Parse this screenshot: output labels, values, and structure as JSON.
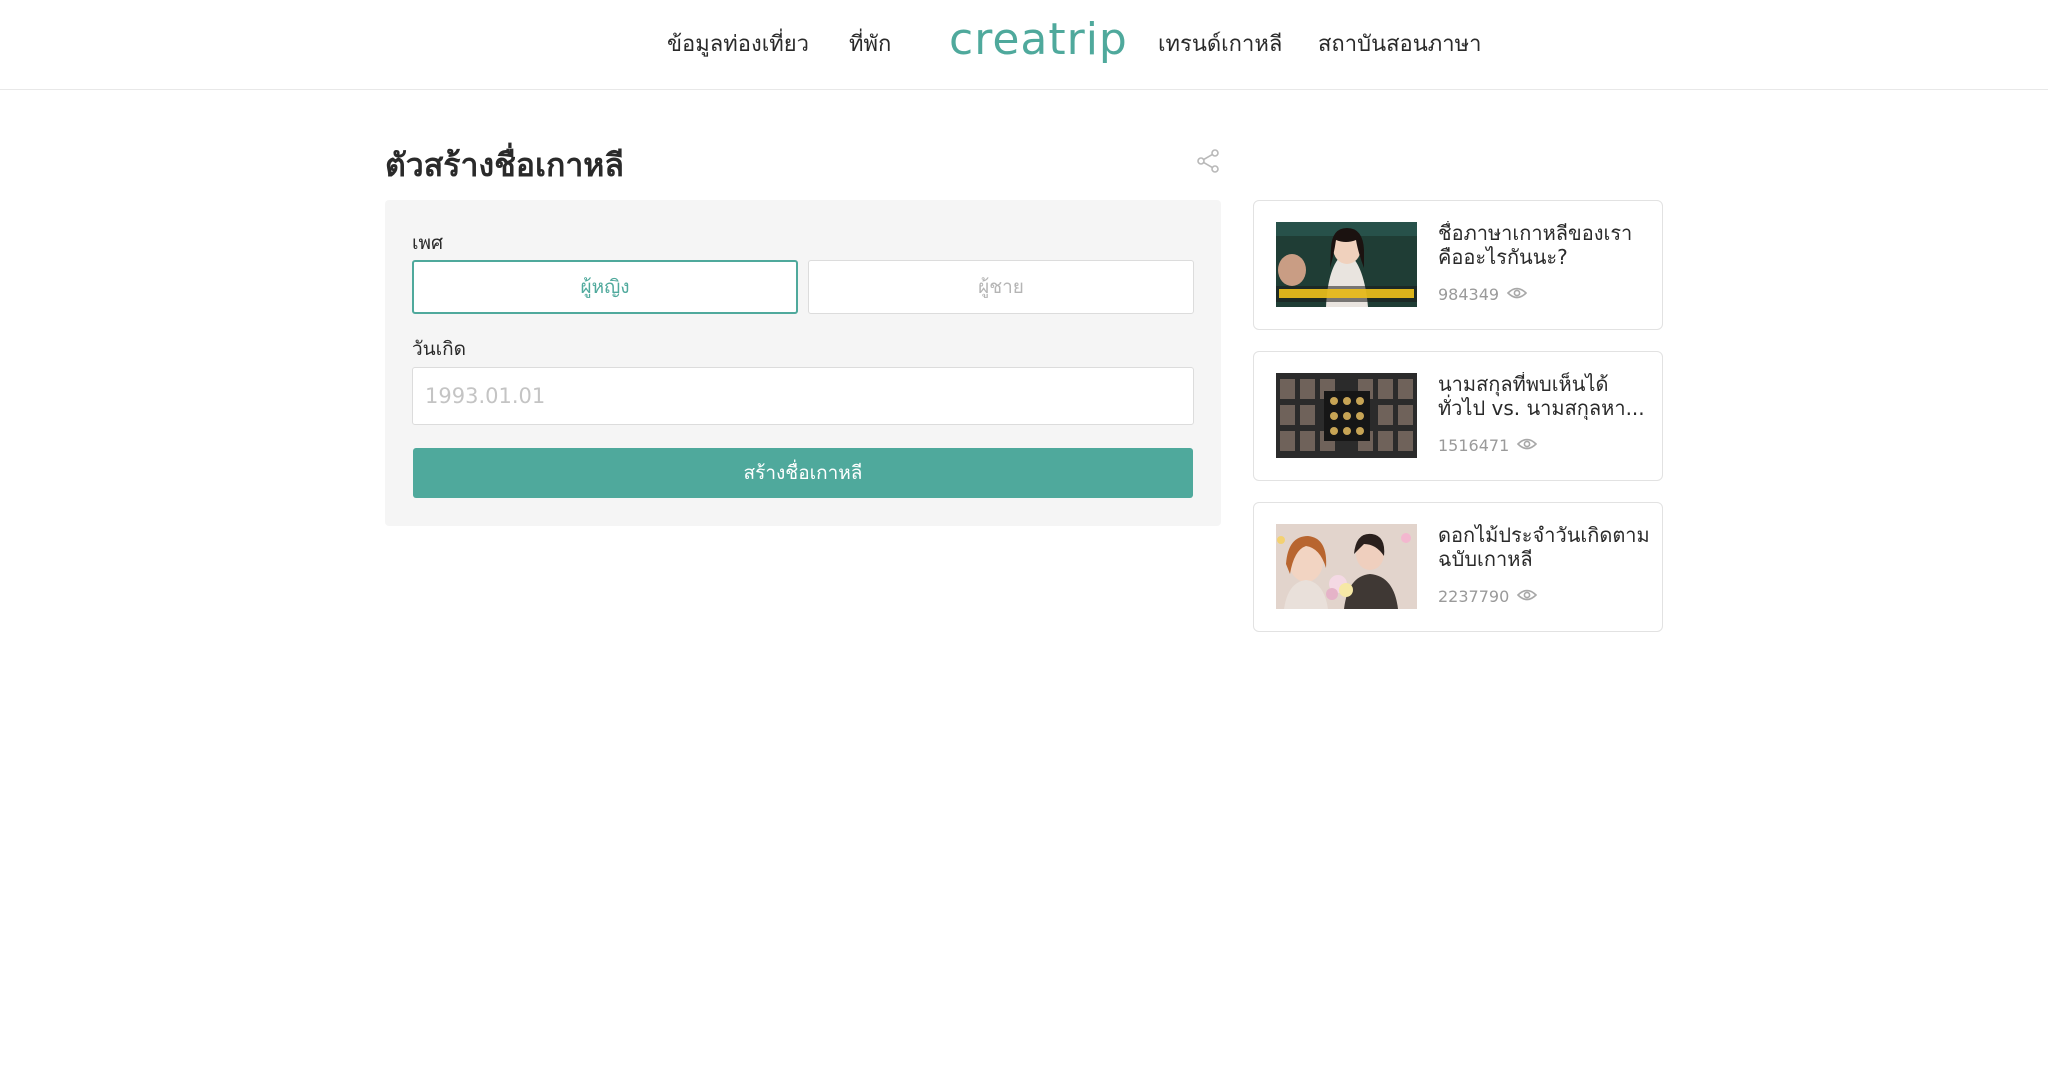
{
  "nav": {
    "items": [
      "ข้อมูลท่องเที่ยว",
      "ที่พัก",
      "เทรนด์เกาหลี",
      "สถาบันสอนภาษา"
    ],
    "logo": "creatrip"
  },
  "page": {
    "title": "ตัวสร้างชื่อเกาหลี"
  },
  "form": {
    "gender_label": "เพศ",
    "gender_options": [
      "ผู้หญิง",
      "ผู้ชาย"
    ],
    "selected_gender": "ผู้หญิง",
    "birth_label": "วันเกิด",
    "birth_placeholder": "1993.01.01",
    "birth_value": "",
    "submit_label": "สร้างชื่อเกาหลี"
  },
  "related": [
    {
      "title": "ชื่อภาษาเกาหลีของเราคืออะไรกันนะ?",
      "views": "984349"
    },
    {
      "title": "นามสกุลที่พบเห็นได้ทั่วไป vs. นามสกุลหา...",
      "views": "1516471"
    },
    {
      "title": "ดอกไม้ประจำวันเกิดตามฉบับเกาหลี",
      "views": "2237790"
    }
  ],
  "colors": {
    "accent": "#4fa99c",
    "panel_bg": "#f5f5f5",
    "muted_text": "#9a9a9a"
  },
  "icons": {
    "share": "share-icon",
    "views": "eye-icon"
  }
}
